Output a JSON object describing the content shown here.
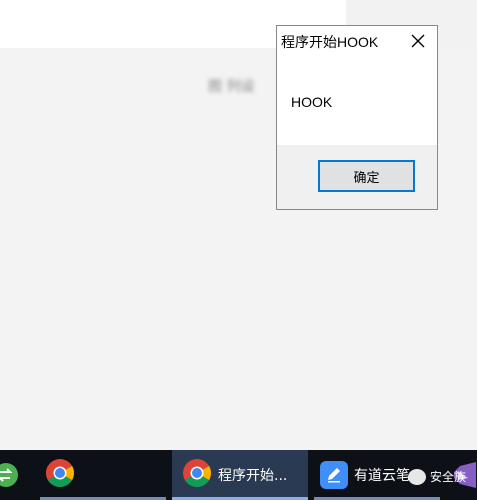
{
  "background": {
    "blurred_text": "图 列设"
  },
  "dialog": {
    "title": "程序开始HOOK",
    "message": "HOOK",
    "ok_label": "确定"
  },
  "taskbar": {
    "items": [
      {
        "label": ""
      },
      {
        "label": "程序开始..."
      },
      {
        "label": "有道云笔"
      }
    ]
  },
  "watermark": {
    "text": "安全族"
  }
}
